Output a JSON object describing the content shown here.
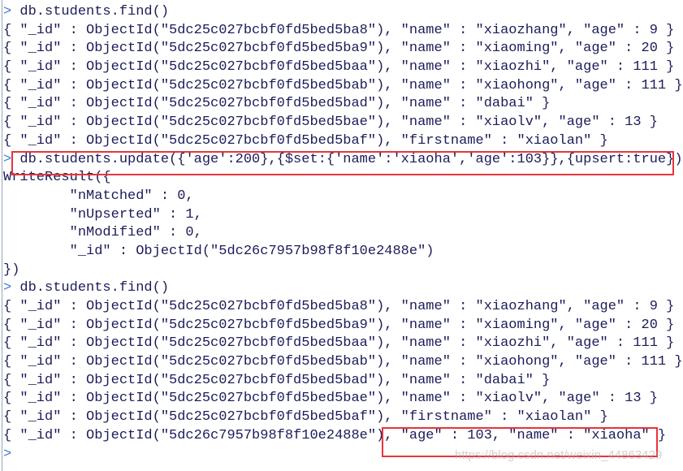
{
  "prompt_symbol": ">",
  "colors": {
    "text": "#1c1c5a",
    "prompt": "#3a7bd5",
    "highlight_box": "#e8343a"
  },
  "lines": [
    {
      "prompt": true,
      "text": "db.students.find()"
    },
    {
      "prompt": false,
      "text": "{ \"_id\" : ObjectId(\"5dc25c027bcbf0fd5bed5ba8\"), \"name\" : \"xiaozhang\", \"age\" : 9 }"
    },
    {
      "prompt": false,
      "text": "{ \"_id\" : ObjectId(\"5dc25c027bcbf0fd5bed5ba9\"), \"name\" : \"xiaoming\", \"age\" : 20 }"
    },
    {
      "prompt": false,
      "text": "{ \"_id\" : ObjectId(\"5dc25c027bcbf0fd5bed5baa\"), \"name\" : \"xiaozhi\", \"age\" : 111 }"
    },
    {
      "prompt": false,
      "text": "{ \"_id\" : ObjectId(\"5dc25c027bcbf0fd5bed5bab\"), \"name\" : \"xiaohong\", \"age\" : 111 }"
    },
    {
      "prompt": false,
      "text": "{ \"_id\" : ObjectId(\"5dc25c027bcbf0fd5bed5bad\"), \"name\" : \"dabai\" }"
    },
    {
      "prompt": false,
      "text": "{ \"_id\" : ObjectId(\"5dc25c027bcbf0fd5bed5bae\"), \"name\" : \"xiaolv\", \"age\" : 13 }"
    },
    {
      "prompt": false,
      "text": "{ \"_id\" : ObjectId(\"5dc25c027bcbf0fd5bed5baf\"), \"firstname\" : \"xiaolan\" }"
    },
    {
      "prompt": true,
      "text": "db.students.update({'age':200},{$set:{'name':'xiaoha','age':103}},{upsert:true})"
    },
    {
      "prompt": false,
      "text": "WriteResult({"
    },
    {
      "prompt": false,
      "text": "        \"nMatched\" : 0,"
    },
    {
      "prompt": false,
      "text": "        \"nUpserted\" : 1,"
    },
    {
      "prompt": false,
      "text": "        \"nModified\" : 0,"
    },
    {
      "prompt": false,
      "text": "        \"_id\" : ObjectId(\"5dc26c7957b98f8f10e2488e\")"
    },
    {
      "prompt": false,
      "text": "})"
    },
    {
      "prompt": true,
      "text": "db.students.find()"
    },
    {
      "prompt": false,
      "text": "{ \"_id\" : ObjectId(\"5dc25c027bcbf0fd5bed5ba8\"), \"name\" : \"xiaozhang\", \"age\" : 9 }"
    },
    {
      "prompt": false,
      "text": "{ \"_id\" : ObjectId(\"5dc25c027bcbf0fd5bed5ba9\"), \"name\" : \"xiaoming\", \"age\" : 20 }"
    },
    {
      "prompt": false,
      "text": "{ \"_id\" : ObjectId(\"5dc25c027bcbf0fd5bed5baa\"), \"name\" : \"xiaozhi\", \"age\" : 111 }"
    },
    {
      "prompt": false,
      "text": "{ \"_id\" : ObjectId(\"5dc25c027bcbf0fd5bed5bab\"), \"name\" : \"xiaohong\", \"age\" : 111 }"
    },
    {
      "prompt": false,
      "text": "{ \"_id\" : ObjectId(\"5dc25c027bcbf0fd5bed5bad\"), \"name\" : \"dabai\" }"
    },
    {
      "prompt": false,
      "text": "{ \"_id\" : ObjectId(\"5dc25c027bcbf0fd5bed5bae\"), \"name\" : \"xiaolv\", \"age\" : 13 }"
    },
    {
      "prompt": false,
      "text": "{ \"_id\" : ObjectId(\"5dc25c027bcbf0fd5bed5baf\"), \"firstname\" : \"xiaolan\" }"
    },
    {
      "prompt": false,
      "text": "{ \"_id\" : ObjectId(\"5dc26c7957b98f8f10e2488e\"), \"age\" : 103, \"name\" : \"xiaoha\" }"
    },
    {
      "prompt": true,
      "text": ""
    }
  ],
  "watermark": "https://blog.csdn.net/weixin_44863429"
}
